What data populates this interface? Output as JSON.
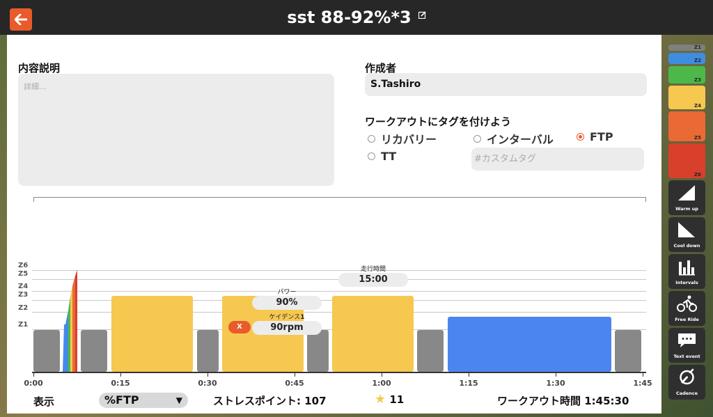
{
  "header": {
    "title": "sst 88-92%*3",
    "back_icon": "arrow-left-icon",
    "edit_icon": "edit-icon"
  },
  "description": {
    "label": "内容説明",
    "placeholder": "詳細..."
  },
  "author": {
    "label": "作成者",
    "value": "S.Tashiro"
  },
  "tags": {
    "label": "ワークアウトにタグを付けよう",
    "options": [
      {
        "label": "リカバリー",
        "selected": false
      },
      {
        "label": "インターバル",
        "selected": false
      },
      {
        "label": "FTP",
        "selected": true
      },
      {
        "label": "TT",
        "selected": false
      }
    ],
    "custom_placeholder": "#カスタムタグ"
  },
  "chart": {
    "zone_labels": [
      "Z6",
      "Z5",
      "Z4",
      "Z3",
      "Z2",
      "Z1"
    ],
    "time_ticks": [
      "0:00",
      "0:15",
      "0:30",
      "0:45",
      "1:00",
      "1:15",
      "1:30",
      "1:45"
    ],
    "duration_caption": "走行時間",
    "duration_value": "15:00",
    "power_caption": "パワー",
    "power_value": "90%",
    "cadence_caption": "ケイデンス",
    "cadence_index": "1",
    "cadence_value": "90rpm",
    "close_label": "X"
  },
  "footer": {
    "display_label": "表示",
    "display_value": "%FTP",
    "stress_label": "ストレスポイント:",
    "stress_value": "107",
    "stars": "11",
    "time_label": "ワークアウト時間",
    "time_value": "1:45:30"
  },
  "sidebar": {
    "zones": [
      "Z1",
      "Z2",
      "Z3",
      "Z4",
      "Z5",
      "Z6"
    ],
    "zone_colors": [
      "#7f7f7f",
      "#3f8de0",
      "#4cb84a",
      "#f6c850",
      "#ea6a35",
      "#d8402c"
    ],
    "tools": [
      {
        "label": "Warm up",
        "icon": "warmup-ramp-icon"
      },
      {
        "label": "Cool down",
        "icon": "cooldown-ramp-icon"
      },
      {
        "label": "Intervals",
        "icon": "intervals-bars-icon"
      },
      {
        "label": "Free Ride",
        "icon": "cyclist-icon"
      },
      {
        "label": "Text event",
        "icon": "chat-bubble-icon"
      },
      {
        "label": "Cadence",
        "icon": "cadence-icon"
      }
    ]
  },
  "colors": {
    "accent": "#ea5a2b",
    "workout_block_yellow": "#f6c850",
    "workout_block_blue": "#4b86f0",
    "workout_block_gray": "#888888"
  }
}
